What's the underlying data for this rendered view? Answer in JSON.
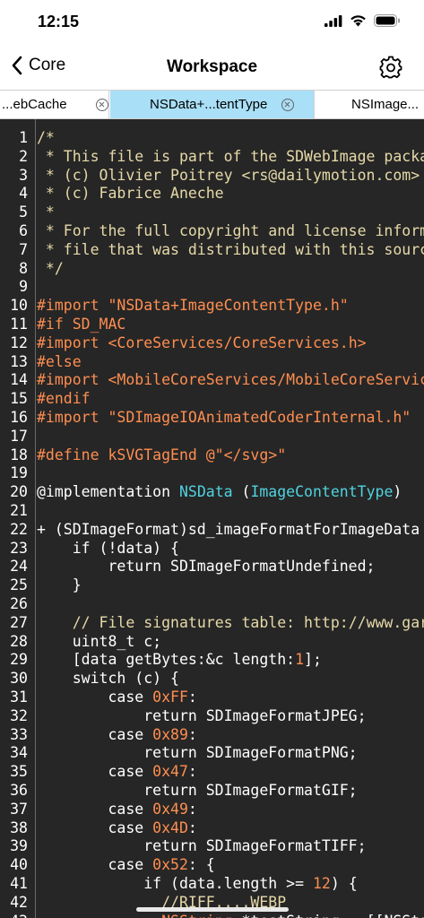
{
  "status_bar": {
    "time": "12:15"
  },
  "nav": {
    "back_label": "Core",
    "title": "Workspace"
  },
  "tabs": [
    {
      "label": "...ebCache",
      "active": false
    },
    {
      "label": "NSData+...tentType",
      "active": true
    },
    {
      "label": "NSImage...",
      "active": false
    }
  ],
  "colors": {
    "active_tab": "#a9dff7",
    "editor_bg": "#262626",
    "comment": "#e6d9a8",
    "preprocessor": "#ff8e50",
    "type": "#4fd3e0"
  },
  "code_lines": [
    {
      "n": "1",
      "t": "/*"
    },
    {
      "n": "2",
      "t": " * This file is part of the SDWebImage package."
    },
    {
      "n": "3",
      "t": " * (c) Olivier Poitrey <rs@dailymotion.com>"
    },
    {
      "n": "4",
      "t": " * (c) Fabrice Aneche"
    },
    {
      "n": "5",
      "t": " *"
    },
    {
      "n": "6",
      "t": " * For the full copyright and license information"
    },
    {
      "n": "7",
      "t": " * file that was distributed with this source code."
    },
    {
      "n": "8",
      "t": " */"
    },
    {
      "n": "9",
      "t": ""
    },
    {
      "n": "10",
      "t": "#import \"NSData+ImageContentType.h\""
    },
    {
      "n": "11",
      "t": "#if SD_MAC"
    },
    {
      "n": "12",
      "t": "#import <CoreServices/CoreServices.h>"
    },
    {
      "n": "13",
      "t": "#else"
    },
    {
      "n": "14",
      "t": "#import <MobileCoreServices/MobileCoreServices.h>"
    },
    {
      "n": "15",
      "t": "#endif"
    },
    {
      "n": "16",
      "t": "#import \"SDImageIOAnimatedCoderInternal.h\""
    },
    {
      "n": "17",
      "t": ""
    },
    {
      "n": "18",
      "t": "#define kSVGTagEnd @\"</svg>\""
    },
    {
      "n": "19",
      "t": ""
    },
    {
      "n": "20",
      "t": "@implementation NSData (ImageContentType)"
    },
    {
      "n": "21",
      "t": ""
    },
    {
      "n": "22",
      "t": "+ (SDImageFormat)sd_imageFormatForImageData"
    },
    {
      "n": "23",
      "t": "    if (!data) {"
    },
    {
      "n": "24",
      "t": "        return SDImageFormatUndefined;"
    },
    {
      "n": "25",
      "t": "    }"
    },
    {
      "n": "26",
      "t": ""
    },
    {
      "n": "27",
      "t": "    // File signatures table: http://www.garykessler"
    },
    {
      "n": "28",
      "t": "    uint8_t c;"
    },
    {
      "n": "29",
      "t": "    [data getBytes:&c length:1];"
    },
    {
      "n": "30",
      "t": "    switch (c) {"
    },
    {
      "n": "31",
      "t": "        case 0xFF:"
    },
    {
      "n": "32",
      "t": "            return SDImageFormatJPEG;"
    },
    {
      "n": "33",
      "t": "        case 0x89:"
    },
    {
      "n": "34",
      "t": "            return SDImageFormatPNG;"
    },
    {
      "n": "35",
      "t": "        case 0x47:"
    },
    {
      "n": "36",
      "t": "            return SDImageFormatGIF;"
    },
    {
      "n": "37",
      "t": "        case 0x49:"
    },
    {
      "n": "38",
      "t": "        case 0x4D:"
    },
    {
      "n": "39",
      "t": "            return SDImageFormatTIFF;"
    },
    {
      "n": "40",
      "t": "        case 0x52: {"
    },
    {
      "n": "41",
      "t": "            if (data.length >= 12) {"
    },
    {
      "n": "42",
      "t": "              //RIFF....WEBP"
    },
    {
      "n": "43",
      "t": "              NSString *testString = [[NSString"
    }
  ]
}
